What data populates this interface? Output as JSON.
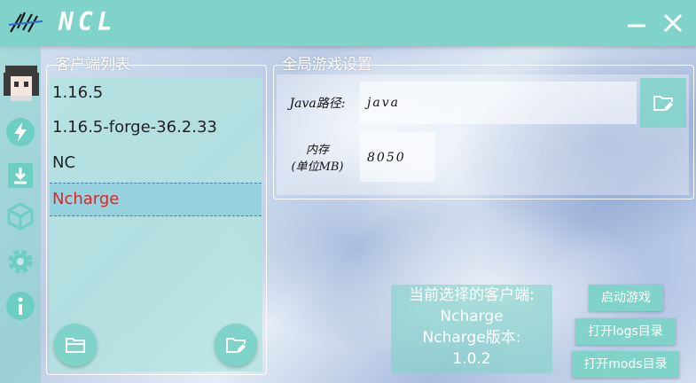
{
  "app": {
    "title": "NCL"
  },
  "sidebar": {
    "items": [
      {
        "name": "avatar"
      },
      {
        "name": "lightning-icon"
      },
      {
        "name": "download-icon"
      },
      {
        "name": "box-icon"
      },
      {
        "name": "gear-icon"
      },
      {
        "name": "info-icon"
      }
    ]
  },
  "client_list": {
    "title": "客户端列表",
    "items": [
      "1.16.5",
      "1.16.5-forge-36.2.33",
      "NC",
      "Ncharge"
    ],
    "selected_index": 3
  },
  "global_settings": {
    "title": "全局游戏设置",
    "java_path_label": "Java路径:",
    "java_path_value": "java",
    "memory_label_line1": "内存",
    "memory_label_line2": "(单位MB)",
    "memory_value": "8050"
  },
  "status": {
    "line1": "当前选择的客户端:",
    "client_name": "Ncharge",
    "version_label": "Ncharge版本:",
    "version_value": "1.0.2"
  },
  "actions": {
    "launch": "启动游戏",
    "open_logs": "打开logs目录",
    "open_mods": "打开mods目录"
  },
  "colors": {
    "accent": "#7fd3c8",
    "selected_text": "#e02424"
  }
}
